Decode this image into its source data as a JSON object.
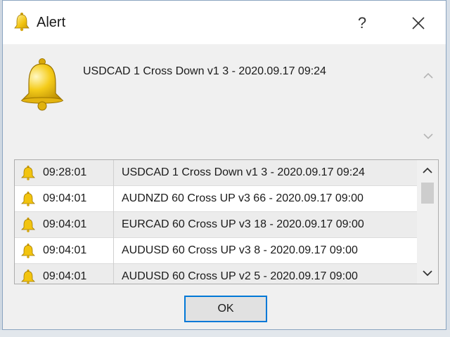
{
  "window": {
    "title": "Alert",
    "help_label": "?"
  },
  "message": "USDCAD 1 Cross Down v1 3 - 2020.09.17 09:24",
  "alerts": [
    {
      "time": "09:28:01",
      "message": "USDCAD 1 Cross Down v1 3 - 2020.09.17 09:24"
    },
    {
      "time": "09:04:01",
      "message": "AUDNZD 60 Cross UP  v3 66 - 2020.09.17 09:00"
    },
    {
      "time": "09:04:01",
      "message": "EURCAD 60 Cross UP  v3 18 - 2020.09.17 09:00"
    },
    {
      "time": "09:04:01",
      "message": "AUDUSD 60 Cross UP  v3 8 - 2020.09.17 09:00"
    },
    {
      "time": "09:04:01",
      "message": "AUDUSD 60 Cross UP  v2 5 - 2020.09.17 09:00"
    }
  ],
  "ok_label": "OK",
  "icons": {
    "title": "bell-icon",
    "main": "bell-icon",
    "row": "bell-icon",
    "close": "close-icon",
    "scroll_up": "chevron-up-icon",
    "scroll_down": "chevron-down-icon"
  },
  "colors": {
    "accent": "#0078d7",
    "bell": "#f2c40f",
    "row_alt": "#ececec"
  }
}
